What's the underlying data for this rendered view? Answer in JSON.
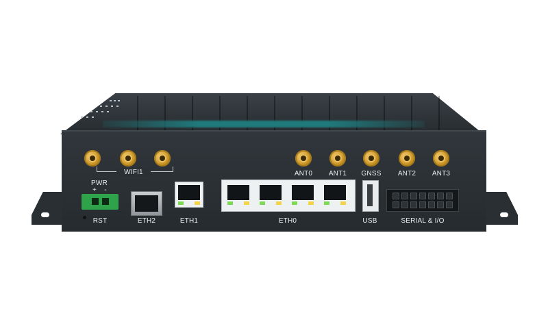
{
  "labels": {
    "wifi1": "WIFI1",
    "ant0": "ANT0",
    "ant1": "ANT1",
    "gnss": "GNSS",
    "ant2": "ANT2",
    "ant3": "ANT3",
    "pwr": "PWR",
    "pwr_plus": "+",
    "pwr_minus": "-",
    "rst": "RST",
    "eth2": "ETH2",
    "eth1": "ETH1",
    "eth0": "ETH0",
    "usb": "USB",
    "serial": "SERIAL & I/O"
  },
  "colors": {
    "chassis": "#2a2f33",
    "antenna_gold": "#c99425",
    "power_connector": "#2fa34a",
    "led_green": "#7ed957",
    "led_yellow": "#f3d34a",
    "accent_teal": "#1f7a7c"
  }
}
